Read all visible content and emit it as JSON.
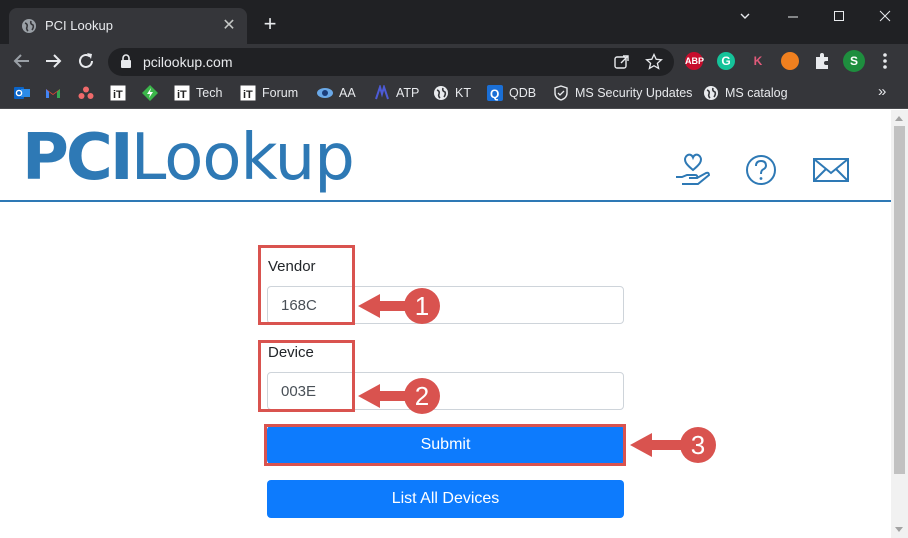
{
  "browser": {
    "tab_title": "PCI Lookup",
    "url": "pcilookup.com",
    "extensions": [
      {
        "name": "adblock-plus",
        "label": "ABP",
        "color": "#c70d2c"
      },
      {
        "name": "grammarly",
        "label": "G",
        "color": "#15c39a"
      },
      {
        "name": "kaspersky",
        "label": "K",
        "color": "#35363a"
      },
      {
        "name": "ext-orange",
        "label": "",
        "color": "#f0801f"
      }
    ],
    "profile_initial": "S",
    "bookmarks": [
      {
        "name": "outlook",
        "label": ""
      },
      {
        "name": "gmail",
        "label": ""
      },
      {
        "name": "asana",
        "label": ""
      },
      {
        "name": "it-icon",
        "label": ""
      },
      {
        "name": "green-diamond",
        "label": ""
      },
      {
        "name": "tech",
        "label": "Tech"
      },
      {
        "name": "forum",
        "label": "Forum"
      },
      {
        "name": "aa",
        "label": "AA"
      },
      {
        "name": "atp",
        "label": "ATP"
      },
      {
        "name": "kt",
        "label": "KT"
      },
      {
        "name": "qdb",
        "label": "QDB"
      },
      {
        "name": "ms-security-updates",
        "label": "MS Security Updates"
      },
      {
        "name": "ms-catalog",
        "label": "MS catalog"
      }
    ]
  },
  "site": {
    "logo_pci": "PCI",
    "logo_lookup": "Lookup",
    "accent_color": "#2e79b5",
    "header_icons": [
      "donate-icon",
      "help-icon",
      "mail-icon"
    ]
  },
  "form": {
    "vendor_label": "Vendor",
    "vendor_value": "168C",
    "device_label": "Device",
    "device_value": "003E",
    "submit_label": "Submit",
    "list_all_label": "List All Devices",
    "button_color": "#0d7bfd"
  },
  "annotations": {
    "color": "#d9534f",
    "callouts": [
      "1",
      "2",
      "3"
    ]
  }
}
